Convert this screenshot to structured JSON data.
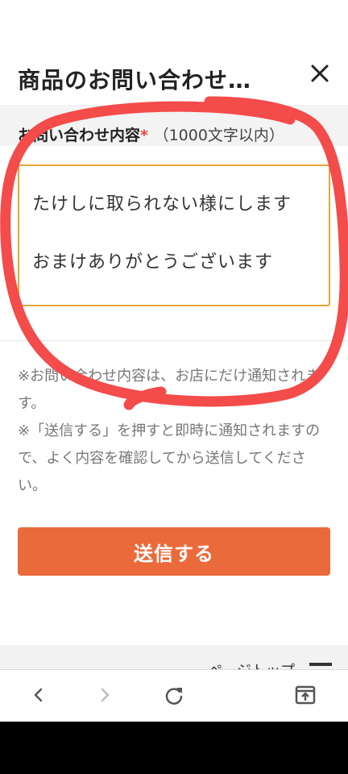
{
  "header": {
    "title": "商品のお問い合わせ…"
  },
  "form": {
    "label": "お問い合わせ内容",
    "required_mark": "*",
    "limit": "（1000文字以内）",
    "textarea_value": "たけしに取られない様にします\n\nおまけありがとうございます"
  },
  "notes": [
    "※お問い合わせ内容は、お店にだけ通知されます。",
    "※「送信する」を押すと即時に通知されますので、よく内容を確認してから送信してください。"
  ],
  "submit_label": "送信する",
  "page_top_label": "ページトップ",
  "colors": {
    "accent": "#eb6a3b",
    "required": "#e5483e",
    "textarea_border": "#e9a53a",
    "annotation": "#f44b4b"
  },
  "icons": {
    "close": "close-icon",
    "back": "chevron-left-icon",
    "forward": "chevron-right-icon",
    "reload": "reload-icon",
    "share": "open-in-app-icon"
  }
}
